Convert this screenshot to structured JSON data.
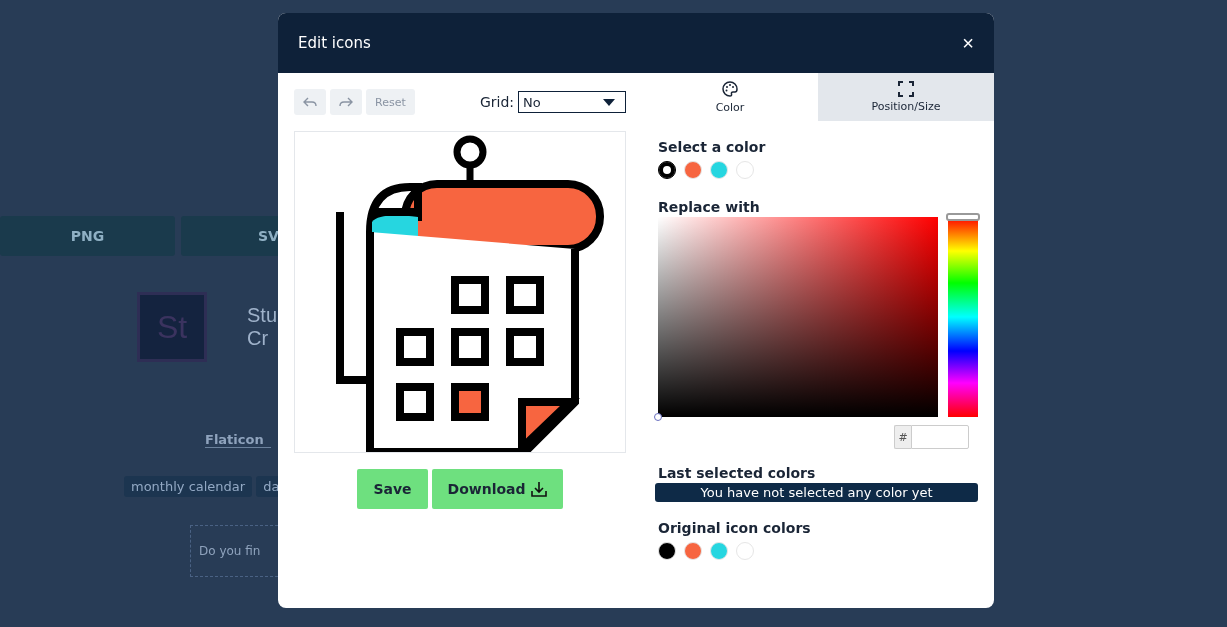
{
  "background": {
    "format_buttons": [
      "PNG",
      "SV"
    ],
    "app_badge": "St",
    "app_title_lines": [
      "Stu",
      "Cr"
    ],
    "author_link": "Flaticon",
    "tags": [
      "monthly calendar",
      "da"
    ],
    "feedback_text": "Do you fin"
  },
  "dialog": {
    "title": "Edit icons",
    "close": "×",
    "toolbar": {
      "reset": "Reset",
      "grid_label": "Grid:",
      "grid_value": "No"
    },
    "actions": {
      "save": "Save",
      "download": "Download"
    },
    "tabs": [
      {
        "label": "Color",
        "kind": "color",
        "selected": true
      },
      {
        "label": "Position/Size",
        "kind": "position",
        "selected": false
      }
    ],
    "select_color": {
      "heading": "Select a color",
      "swatches": [
        {
          "color": "#000000",
          "selected": true
        },
        {
          "color": "#f76540",
          "selected": false
        },
        {
          "color": "#26d6e0",
          "selected": false
        },
        {
          "color": "#ffffff",
          "selected": false
        }
      ]
    },
    "replace_with": {
      "heading": "Replace with",
      "hex_prefix": "#",
      "hue": {
        "level": 0
      }
    },
    "last_selected": {
      "heading": "Last selected colors",
      "message": "You have not selected any color yet"
    },
    "original_colors": {
      "heading": "Original icon colors",
      "swatches": [
        {
          "color": "#000000"
        },
        {
          "color": "#f76540"
        },
        {
          "color": "#26d6e0"
        },
        {
          "color": "#ffffff"
        }
      ]
    }
  }
}
